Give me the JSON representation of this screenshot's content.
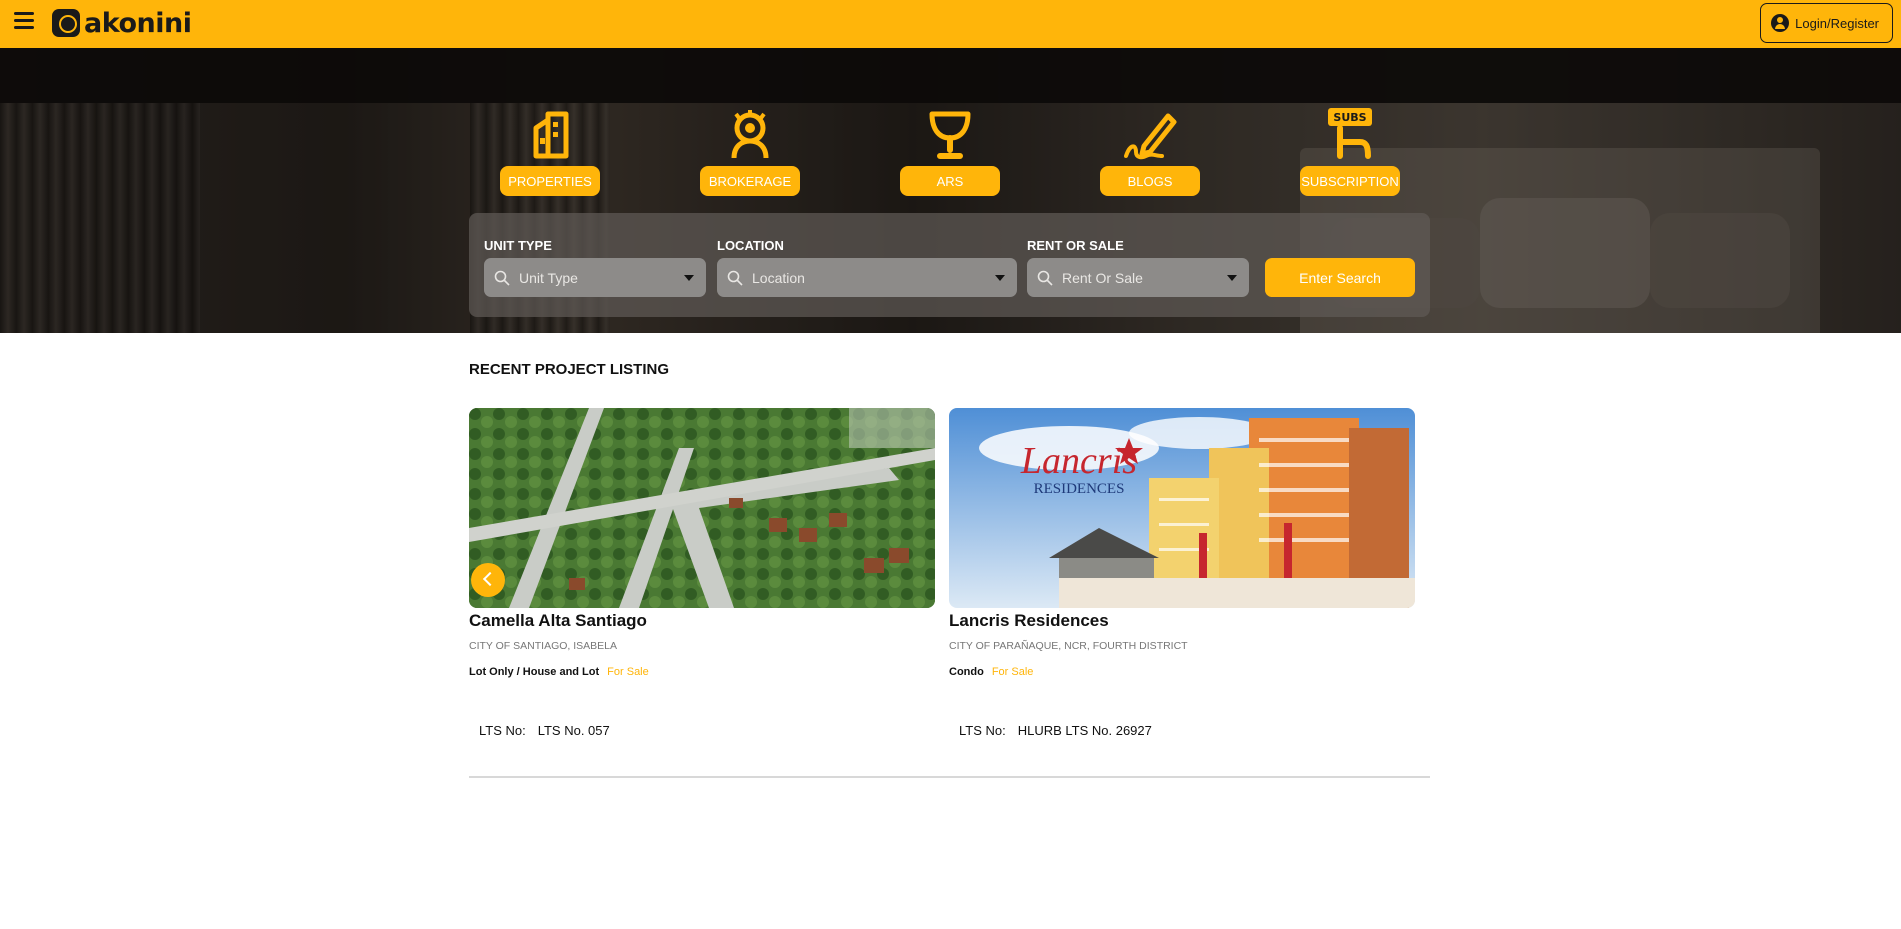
{
  "header": {
    "brand": "akonini",
    "login_label": "Login/Register"
  },
  "categories": [
    {
      "label": "PROPERTIES",
      "icon": "building-icon"
    },
    {
      "label": "BROKERAGE",
      "icon": "agent-badge-icon"
    },
    {
      "label": "ARS",
      "icon": "trophy-icon"
    },
    {
      "label": "BLOGS",
      "icon": "pen-signature-icon"
    },
    {
      "label": "SUBSCRIPTION",
      "icon": "subscription-hand-icon",
      "badge": "SUBS"
    }
  ],
  "search": {
    "unit_type": {
      "label": "UNIT TYPE",
      "placeholder": "Unit Type"
    },
    "location": {
      "label": "LOCATION",
      "placeholder": "Location"
    },
    "rent_or_sale": {
      "label": "RENT OR SALE",
      "placeholder": "Rent Or Sale"
    },
    "button_label": "Enter Search"
  },
  "listing": {
    "title": "RECENT PROJECT LISTING",
    "cards": [
      {
        "name": "Camella Alta Santiago",
        "location": "CITY OF SANTIAGO, ISABELA",
        "type": "Lot Only / House and Lot",
        "status": "For Sale",
        "lts_label": "LTS No:",
        "lts_value": "LTS No. 057"
      },
      {
        "name": "Lancris Residences",
        "location": "CITY OF PARAÑAQUE, NCR, FOURTH DISTRICT",
        "type": "Condo",
        "status": "For Sale",
        "lts_label": "LTS No:",
        "lts_value": "HLURB LTS No. 26927",
        "logo_line1": "Lancris",
        "logo_line2": "RESIDENCES"
      }
    ]
  },
  "colors": {
    "accent": "#ffb50a",
    "dark": "#1a1a1a"
  }
}
